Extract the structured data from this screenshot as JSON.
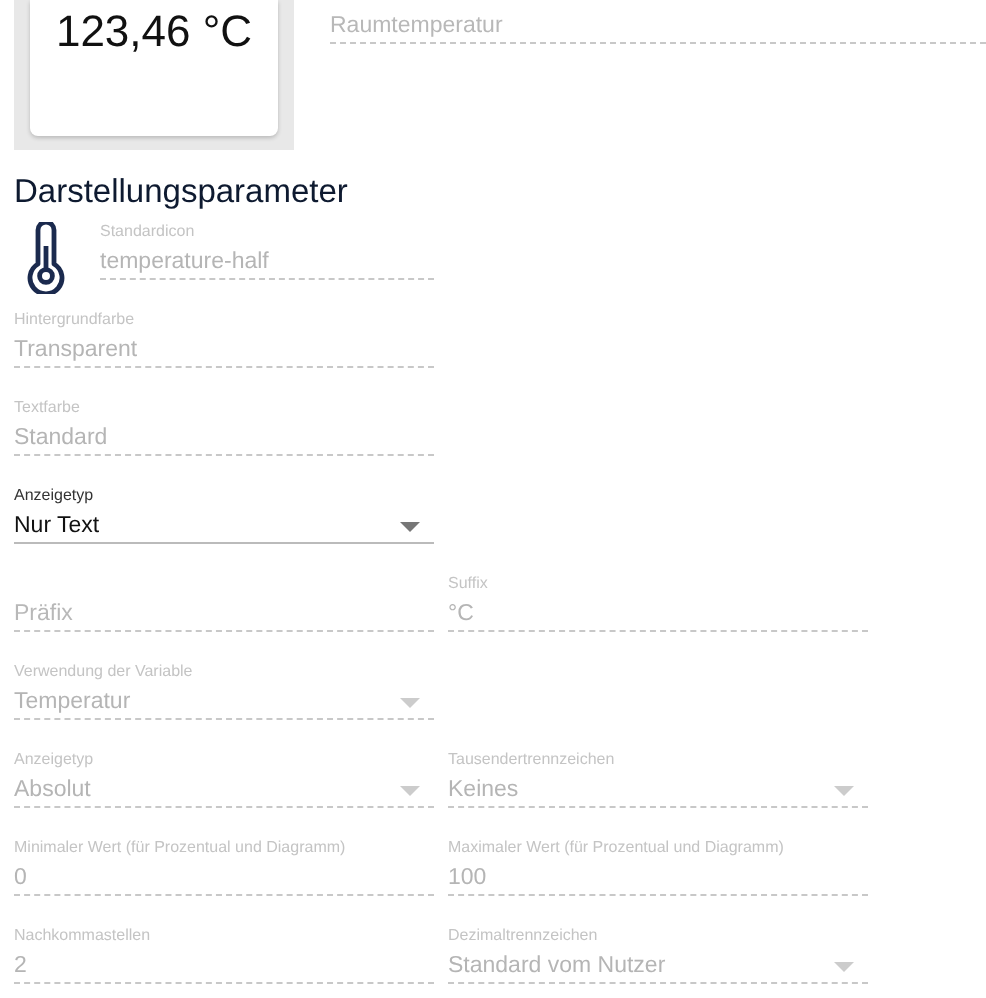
{
  "preview": {
    "value": "123,46 °C"
  },
  "title_field": {
    "placeholder": "Raumtemperatur",
    "disabled": true
  },
  "section_title": "Darstellungsparameter",
  "icon_field": {
    "label": "Standardicon",
    "value": "temperature-half",
    "disabled": true
  },
  "rows": [
    [
      {
        "kind": "text",
        "label": "Hintergrundfarbe",
        "value": "Transparent",
        "disabled": true
      }
    ],
    [
      {
        "kind": "text",
        "label": "Textfarbe",
        "value": "Standard",
        "disabled": true
      }
    ],
    [
      {
        "kind": "select",
        "label": "Anzeigetyp",
        "value": "Nur Text",
        "disabled": false
      }
    ],
    [
      {
        "kind": "text",
        "placeholder": "Präfix",
        "disabled": true
      },
      {
        "kind": "text",
        "label": "Suffix",
        "value": "°C",
        "disabled": true
      }
    ],
    [
      {
        "kind": "select",
        "label": "Verwendung der Variable",
        "value": "Temperatur",
        "disabled": true
      }
    ],
    [
      {
        "kind": "select",
        "label": "Anzeigetyp",
        "value": "Absolut",
        "disabled": true
      },
      {
        "kind": "select",
        "label": "Tausendertrennzeichen",
        "value": "Keines",
        "disabled": true
      }
    ],
    [
      {
        "kind": "text",
        "label": "Minimaler Wert (für Prozentual und Diagramm)",
        "value": "0",
        "disabled": true
      },
      {
        "kind": "text",
        "label": "Maximaler Wert (für Prozentual und Diagramm)",
        "value": "100",
        "disabled": true
      }
    ],
    [
      {
        "kind": "text",
        "label": "Nachkommastellen",
        "value": "2",
        "disabled": true
      },
      {
        "kind": "select",
        "label": "Dezimaltrennzeichen",
        "value": "Standard vom Nutzer",
        "disabled": true
      }
    ]
  ]
}
